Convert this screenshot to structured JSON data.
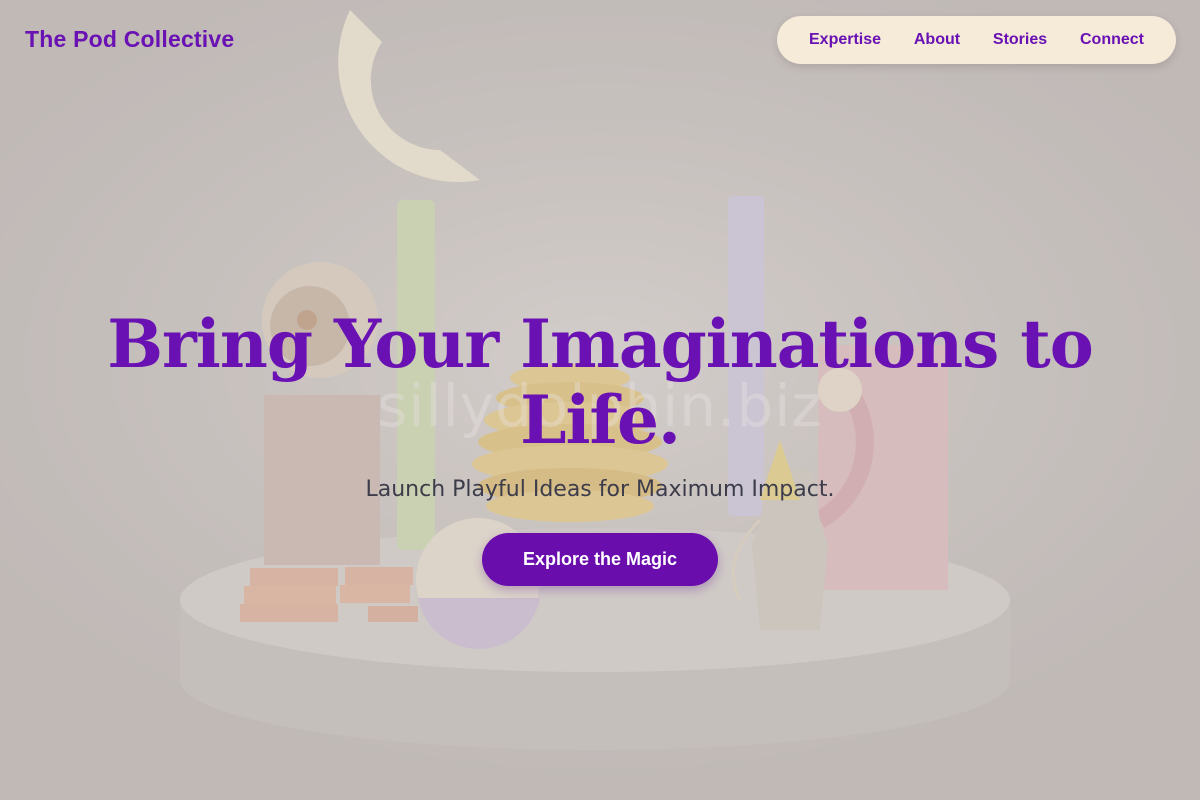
{
  "header": {
    "brand": "The Pod Collective"
  },
  "nav": {
    "items": [
      {
        "label": "Expertise"
      },
      {
        "label": "About"
      },
      {
        "label": "Stories"
      },
      {
        "label": "Connect"
      }
    ]
  },
  "hero": {
    "watermark": "sillydolphin.biz",
    "headline": "Bring Your Imaginations to Life.",
    "subheadline": "Launch Playful Ideas for Maximum Impact.",
    "cta_label": "Explore the Magic"
  },
  "colors": {
    "accent": "#6a11b4",
    "nav_background": "#f5ebd8",
    "cta_background": "#6a0dad"
  }
}
